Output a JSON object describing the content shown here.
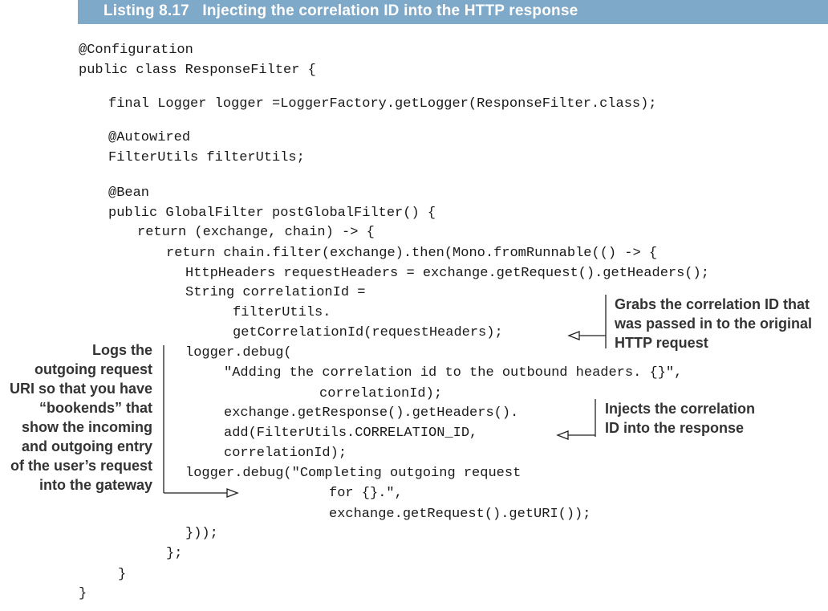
{
  "listing": {
    "title": "Listing 8.17   Injecting the correlation ID into the HTTP response"
  },
  "code": {
    "lines": [
      "@Configuration",
      "public class ResponseFilter {",
      "final Logger logger =LoggerFactory.getLogger(ResponseFilter.class);",
      "@Autowired",
      "FilterUtils filterUtils;",
      "@Bean",
      "public GlobalFilter postGlobalFilter() {",
      "return (exchange, chain) -> {",
      "return chain.filter(exchange).then(Mono.fromRunnable(() -> {",
      "HttpHeaders requestHeaders = exchange.getRequest().getHeaders();",
      "String correlationId =",
      "filterUtils.",
      "getCorrelationId(requestHeaders);",
      "logger.debug(",
      "\"Adding the correlation id to the outbound headers. {}\",",
      "correlationId);",
      "exchange.getResponse().getHeaders().",
      "add(FilterUtils.CORRELATION_ID,",
      "correlationId);",
      "logger.debug(\"Completing outgoing request",
      "for {}.\",",
      "exchange.getRequest().getURI());",
      "}));",
      "};",
      "}",
      "}"
    ]
  },
  "annotations": {
    "grabs": [
      "Grabs the correlation ID that",
      "was passed in to the original",
      "HTTP request"
    ],
    "injects": [
      "Injects the correlation",
      "ID into the response"
    ],
    "logs": [
      "Logs the",
      "outgoing request",
      "URI so that you have",
      "“bookends” that",
      "show the incoming",
      "and outgoing entry",
      "of the user’s request",
      "into the gateway"
    ]
  }
}
